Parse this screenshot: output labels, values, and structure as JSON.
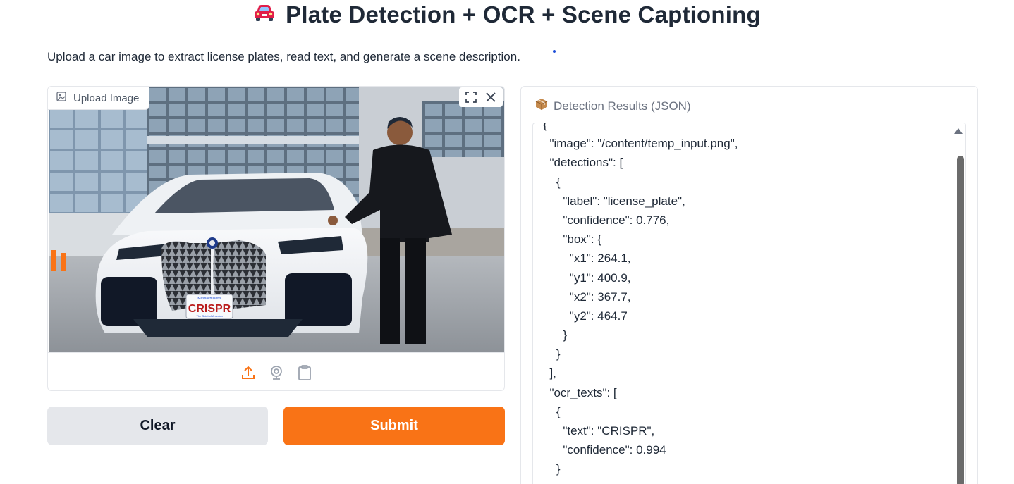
{
  "header": {
    "title": "Plate Detection + OCR + Scene Captioning",
    "title_icon": "car-icon",
    "subtitle": "Upload a car image to extract license plates, read text, and generate a scene description."
  },
  "image_input": {
    "label": "Upload Image",
    "label_icon": "image-icon",
    "tools": [
      "fullscreen-icon",
      "close-icon"
    ],
    "plate_text": "CRISPR",
    "plate_top_text": "Massachusetts",
    "plate_bottom_text": "The Spirit of America",
    "source_icons": [
      "upload-icon",
      "webcam-icon",
      "clipboard-icon"
    ],
    "active_source_color": "#f97316"
  },
  "buttons": {
    "clear_label": "Clear",
    "submit_label": "Submit"
  },
  "output": {
    "label": "Detection Results (JSON)",
    "label_icon": "package-icon",
    "json_lines": [
      "{",
      "  \"image\": \"/content/temp_input.png\",",
      "  \"detections\": [",
      "    {",
      "      \"label\": \"license_plate\",",
      "      \"confidence\": 0.776,",
      "      \"box\": {",
      "        \"x1\": 264.1,",
      "        \"y1\": 400.9,",
      "        \"x2\": 367.7,",
      "        \"y2\": 464.7",
      "      }",
      "    }",
      "  ],",
      "  \"ocr_texts\": [",
      "    {",
      "      \"text\": \"CRISPR\",",
      "      \"confidence\": 0.994",
      "    }"
    ]
  },
  "colors": {
    "accent": "#f97316",
    "secondary_button": "#e5e7eb",
    "text": "#1f2937",
    "muted": "#6b7280"
  }
}
